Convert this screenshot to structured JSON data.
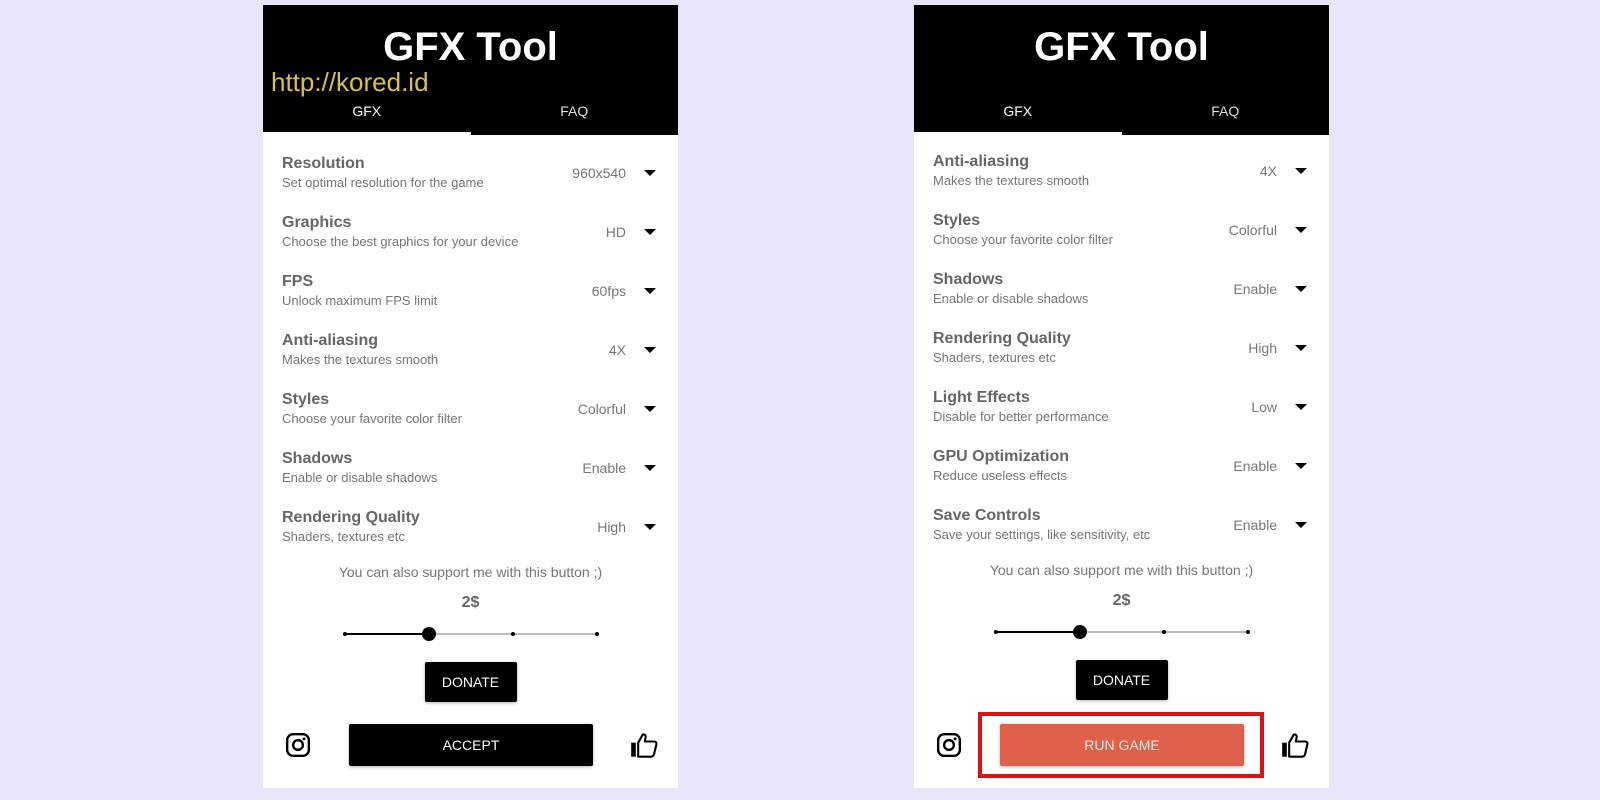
{
  "colors": {
    "background": "#e6e6f8",
    "header": "#000000",
    "watermark": "#d9bf52",
    "run_button": "#e0614b",
    "highlight": "#dd1111"
  },
  "left": {
    "header": {
      "title": "GFX Tool",
      "watermark": "http://kored.id"
    },
    "tabs": [
      {
        "label": "GFX",
        "active": true
      },
      {
        "label": "FAQ",
        "active": false
      }
    ],
    "settings": [
      {
        "title": "Resolution",
        "subtitle": "Set optimal resolution for the game",
        "value": "960x540"
      },
      {
        "title": "Graphics",
        "subtitle": "Choose the best graphics for your device",
        "value": "HD"
      },
      {
        "title": "FPS",
        "subtitle": "Unlock maximum FPS limit",
        "value": "60fps"
      },
      {
        "title": "Anti-aliasing",
        "subtitle": "Makes the textures smooth",
        "value": "4X"
      },
      {
        "title": "Styles",
        "subtitle": "Choose your favorite color filter",
        "value": "Colorful"
      },
      {
        "title": "Shadows",
        "subtitle": "Enable or disable shadows",
        "value": "Enable"
      },
      {
        "title": "Rendering Quality",
        "subtitle": "Shaders, textures etc",
        "value": "High"
      }
    ],
    "support_text": "You can also support me with this button ;)",
    "donation": {
      "amount_label": "2$",
      "step_index": 1,
      "step_count": 4
    },
    "donate_label": "DONATE",
    "main_button_label": "ACCEPT"
  },
  "right": {
    "header": {
      "title": "GFX Tool"
    },
    "tabs": [
      {
        "label": "GFX",
        "active": true
      },
      {
        "label": "FAQ",
        "active": false
      }
    ],
    "settings": [
      {
        "title": "Anti-aliasing",
        "subtitle": "Makes the textures smooth",
        "value": "4X"
      },
      {
        "title": "Styles",
        "subtitle": "Choose your favorite color filter",
        "value": "Colorful"
      },
      {
        "title": "Shadows",
        "subtitle": "Enable or disable shadows",
        "value": "Enable"
      },
      {
        "title": "Rendering Quality",
        "subtitle": "Shaders, textures etc",
        "value": "High"
      },
      {
        "title": "Light Effects",
        "subtitle": "Disable for better performance",
        "value": "Low"
      },
      {
        "title": "GPU Optimization",
        "subtitle": "Reduce useless effects",
        "value": "Enable"
      },
      {
        "title": "Save Controls",
        "subtitle": "Save your settings, like sensitivity, etc",
        "value": "Enable"
      }
    ],
    "support_text": "You can also support me with this button ;)",
    "donation": {
      "amount_label": "2$",
      "step_index": 1,
      "step_count": 4
    },
    "donate_label": "DONATE",
    "main_button_label": "RUN GAME"
  },
  "icons": {
    "instagram": "instagram-icon",
    "like": "thumbs-up-icon",
    "dropdown": "caret-down-icon"
  }
}
